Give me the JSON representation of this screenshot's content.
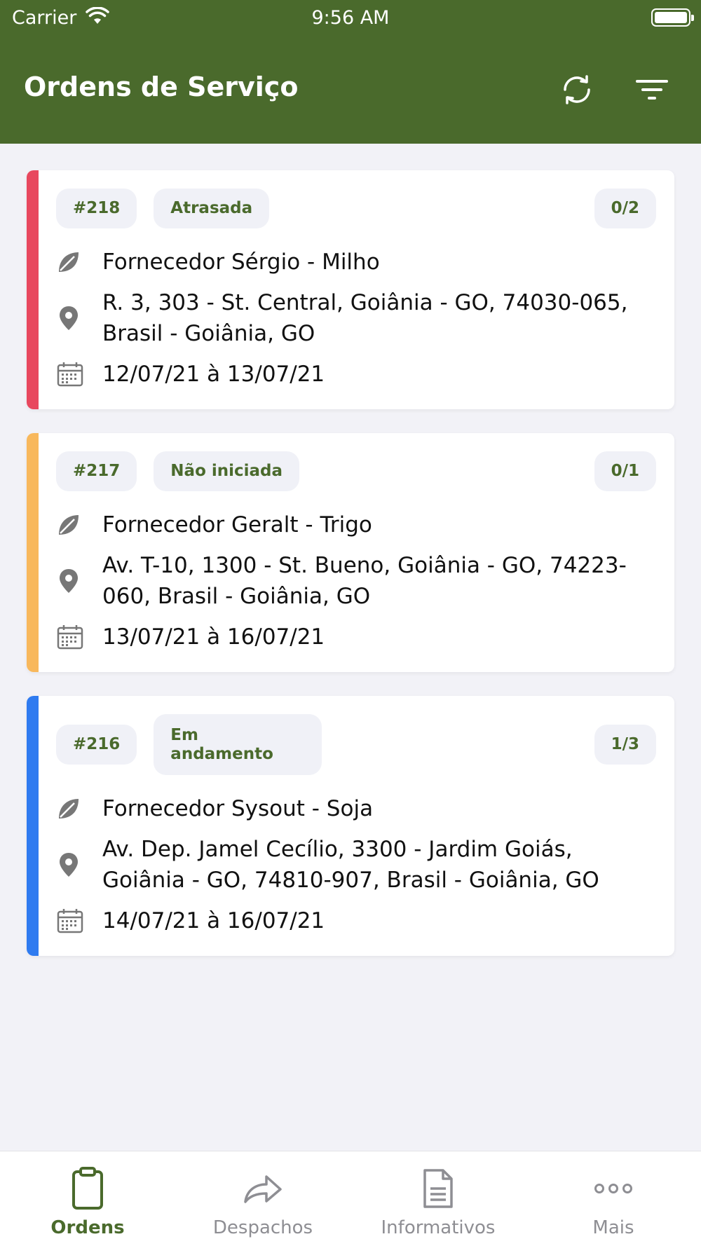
{
  "status_bar": {
    "carrier": "Carrier",
    "time": "9:56 AM"
  },
  "header": {
    "title": "Ordens de Serviço"
  },
  "colors": {
    "brand": "#4a6a2c",
    "late": "#e8485e",
    "not_started": "#f8b85c",
    "in_progress": "#2f7bf0"
  },
  "orders": [
    {
      "number": "#218",
      "status": "Atrasada",
      "progress": "0/2",
      "accent": "#e8485e",
      "supplier": "Fornecedor Sérgio - Milho",
      "address": "R. 3, 303 - St. Central, Goiânia - GO, 74030-065, Brasil - Goiânia, GO",
      "dates": "12/07/21 à 13/07/21"
    },
    {
      "number": "#217",
      "status": "Não iniciada",
      "progress": "0/1",
      "accent": "#f8b85c",
      "supplier": "Fornecedor Geralt - Trigo",
      "address": "Av. T-10, 1300 - St. Bueno, Goiânia - GO, 74223-060, Brasil - Goiânia, GO",
      "dates": "13/07/21 à 16/07/21"
    },
    {
      "number": "#216",
      "status": "Em andamento",
      "progress": "1/3",
      "accent": "#2f7bf0",
      "supplier": "Fornecedor Sysout - Soja",
      "address": "Av. Dep. Jamel Cecílio, 3300 - Jardim Goiás, Goiânia - GO, 74810-907, Brasil - Goiânia, GO",
      "dates": "14/07/21 à 16/07/21"
    }
  ],
  "tabbar": [
    {
      "label": "Ordens",
      "icon": "clipboard-icon",
      "active": true
    },
    {
      "label": "Despachos",
      "icon": "share-icon",
      "active": false
    },
    {
      "label": "Informativos",
      "icon": "document-icon",
      "active": false
    },
    {
      "label": "Mais",
      "icon": "more-icon",
      "active": false
    }
  ]
}
